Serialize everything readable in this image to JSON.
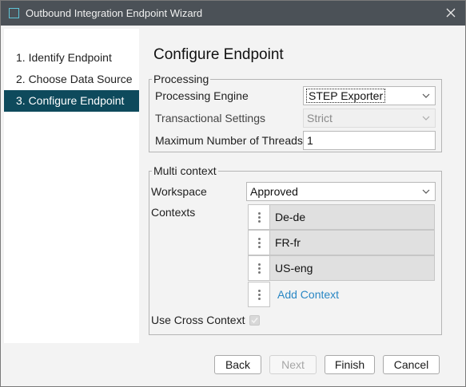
{
  "window": {
    "title": "Outbound Integration Endpoint Wizard"
  },
  "steps": [
    {
      "label": "1. Identify Endpoint",
      "active": false
    },
    {
      "label": "2. Choose Data Source",
      "active": false
    },
    {
      "label": "3. Configure Endpoint",
      "active": true
    }
  ],
  "page": {
    "heading": "Configure Endpoint"
  },
  "processing": {
    "group_title": "Processing",
    "engine_label": "Processing Engine",
    "engine_value": "STEP Exporter",
    "transactional_label": "Transactional Settings",
    "transactional_value": "Strict",
    "threads_label": "Maximum Number of Threads",
    "threads_value": "1"
  },
  "multi_context": {
    "group_title": "Multi context",
    "workspace_label": "Workspace",
    "workspace_value": "Approved",
    "contexts_label": "Contexts",
    "contexts": [
      "De-de",
      "FR-fr",
      "US-eng"
    ],
    "add_context_label": "Add Context",
    "cross_context_label": "Use Cross Context",
    "cross_context_checked": true
  },
  "buttons": {
    "back": "Back",
    "next": "Next",
    "finish": "Finish",
    "cancel": "Cancel"
  },
  "colors": {
    "titlebar": "#4b5157",
    "active_step": "#0e4a5c",
    "link": "#2a87c4"
  }
}
